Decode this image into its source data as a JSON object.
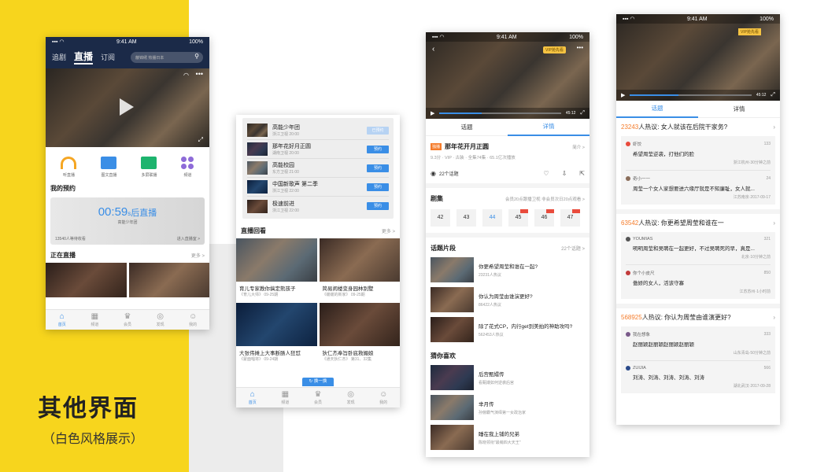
{
  "slogan": {
    "title": "其他界面",
    "subtitle": "（白色风格展示）"
  },
  "p1": {
    "time": "9:41 AM",
    "battery": "100%",
    "tabs": [
      "追剧",
      "直播",
      "订阅"
    ],
    "search_placeholder": "蔽锦绣 热播日本",
    "icons": [
      {
        "label": "听直播",
        "icon": "headphones-icon",
        "color": "#f5a623"
      },
      {
        "label": "图文直播",
        "icon": "image-icon",
        "color": "#3a8ee6"
      },
      {
        "label": "多屏联播",
        "icon": "multiscreen-icon",
        "color": "#1db46e"
      },
      {
        "label": "频道",
        "icon": "grid-icon",
        "color": "#8e6bd8"
      }
    ],
    "reservation_title": "我的预约",
    "countdown": "00:59",
    "countdown_unit": "s",
    "countdown_suffix": "后直播",
    "countdown_show": "高能少年团",
    "waiting": "13540人等待收看",
    "enter": "进入直播室 >",
    "live_title": "正在直播",
    "more": "更多 >",
    "tabbar": [
      "首页",
      "频道",
      "会员",
      "发现",
      "我的"
    ]
  },
  "p2": {
    "list": [
      {
        "title": "高能少年团",
        "sub": "浙江卫视 20:00",
        "btn": "已预约"
      },
      {
        "title": "那年花好月正圆",
        "sub": "湖南卫视 20:00",
        "btn": "预约"
      },
      {
        "title": "高能校园",
        "sub": "东方卫视 21:00",
        "btn": "预约"
      },
      {
        "title": "中国新歌声 第二季",
        "sub": "浙江卫视 22:00",
        "btn": "预约"
      },
      {
        "title": "极速前进",
        "sub": "浙江卫视 22:00",
        "btn": "预约"
      }
    ],
    "replay_title": "直播回看",
    "more": "更多 >",
    "grid": [
      {
        "title": "育儿专家教你搞定熊孩子",
        "sub": "《育儿大师》 09-25期"
      },
      {
        "title": "简易闹楼变身园林别墅",
        "sub": "《缓缓的新家》 09-25期"
      },
      {
        "title": "大张伟摊上大事断肠人狂怼",
        "sub": "《蒙面唱将》 09-24期"
      },
      {
        "title": "狄仁杰奉旨卧底救媚娘",
        "sub": "《通天狄仁杰》 第31、32集"
      }
    ],
    "refresh": "换一换",
    "tabbar": [
      "首页",
      "频道",
      "会员",
      "发现",
      "我的"
    ]
  },
  "p3": {
    "time": "9:41 AM",
    "battery": "100%",
    "vip_tag": "VIP抢先看",
    "progress_time": "45:12",
    "tabs": [
      "话题",
      "详情"
    ],
    "badge": "独播",
    "title": "那年花开月正圆",
    "intro": "简介 >",
    "meta": "9.3分 · VIP · 古装 · 全集74集 · 65.1亿次播放",
    "topics_count": "22个话题",
    "ep_title": "剧集",
    "ep_note": "会员20点跟播卫视 非会员次日20点观看 >",
    "episodes": [
      "42",
      "43",
      "44",
      "45",
      "46",
      "47"
    ],
    "clips_title": "话题片段",
    "clips_more": "22个话题 >",
    "clips": [
      {
        "q": "你更希望周莹和谁在一起?",
        "n": "23231人热议"
      },
      {
        "q": "你认为周莹由谁演更好?",
        "n": "86422人热议"
      },
      {
        "q": "除了花式CP，内行get到美拍的神助攻吗?",
        "n": "562453人热议"
      }
    ],
    "like_title": "猜你喜欢",
    "likes": [
      {
        "t": "后宫甄嬛传",
        "s": "看甄嬛如何逆袭后宫"
      },
      {
        "t": "芈月传",
        "s": "孙俪霸气演绎第一女政治家"
      },
      {
        "t": "睡在我上铺的兄弟",
        "s": "陈晓领衔\"最萌四大天王\""
      }
    ]
  },
  "p4": {
    "time": "9:41 AM",
    "battery": "100%",
    "vip_tag": "VIP抢先看",
    "time_code": "45:12",
    "tabs": [
      "话题",
      "详情"
    ],
    "topics": [
      {
        "count": "23243",
        "label": "人热议: 女人就该在后院干家务?",
        "comments": [
          {
            "user": "虾饺",
            "text": "希望周莹逆袭，打他们的脸",
            "likes": "133",
            "loc": "浙江杭州·30分钟之前"
          },
          {
            "user": "奇小一一",
            "text": "周莹一个女人家想要进六缘厅就是不知廉耻，女人就...",
            "likes": "24",
            "loc": "江苏南京·2017-09-17"
          }
        ]
      },
      {
        "count": "63542",
        "label": "人热议: 你更希望周莹和谁在一",
        "comments": [
          {
            "user": "YOUMIAS",
            "text": "明明周莹和吴聘在一起更好，不过吴聘死的早，真是...",
            "likes": "321",
            "loc": "北京·10分钟之前"
          },
          {
            "user": "你个小皮尺",
            "text": "傲娇的女人，活该守寡",
            "likes": "850",
            "loc": "江苏苏州·1小时前"
          }
        ]
      },
      {
        "count": "568925",
        "label": "人热议: 你认为周莹由谁演更好?",
        "comments": [
          {
            "user": "我在想象",
            "text": "赵丽颖赵丽颖赵丽颖赵丽颖",
            "likes": "333",
            "loc": "山东青岛·50分钟之前"
          },
          {
            "user": "ZUIJIA",
            "text": "刘涛、刘涛、刘涛、刘涛、刘涛",
            "likes": "566",
            "loc": "湖北武汉·2017-09-28"
          }
        ]
      }
    ]
  },
  "colors": {
    "yellow": "#f7d51d",
    "blue": "#3a8ee6",
    "orange": "#f57c2b"
  }
}
